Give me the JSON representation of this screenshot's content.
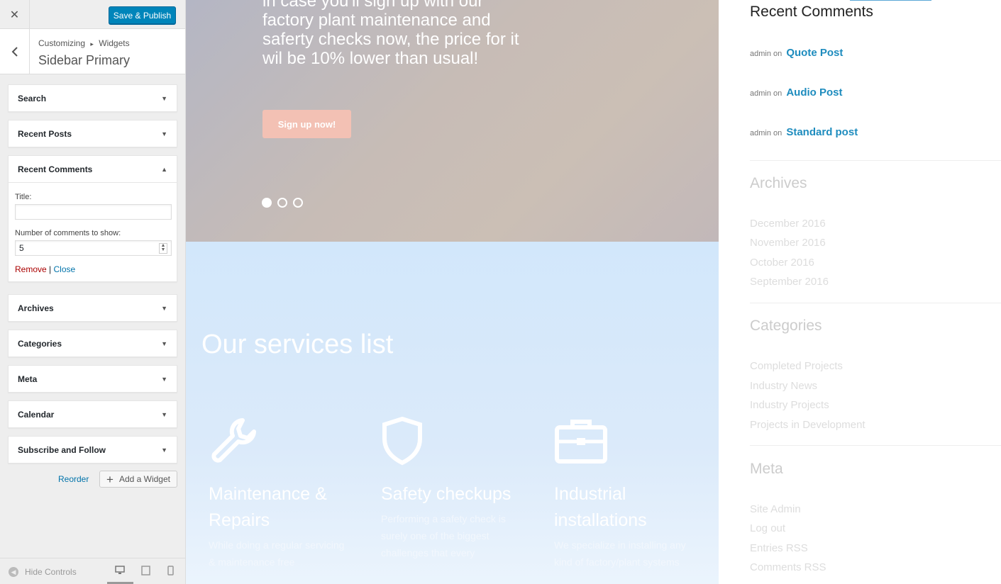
{
  "panel": {
    "close_icon": "close-icon",
    "publish_label": "Save & Publish",
    "breadcrumb_root": "Customizing",
    "breadcrumb_sep": "▸",
    "breadcrumb_leaf": "Widgets",
    "section_title": "Sidebar Primary",
    "widgets": [
      {
        "label": "Search"
      },
      {
        "label": "Recent Posts"
      },
      {
        "label": "Recent Comments"
      },
      {
        "label": "Archives"
      },
      {
        "label": "Categories"
      },
      {
        "label": "Meta"
      },
      {
        "label": "Calendar"
      },
      {
        "label": "Subscribe and Follow"
      }
    ],
    "form": {
      "title_label": "Title:",
      "title_value": "",
      "count_label": "Number of comments to show:",
      "count_value": "5",
      "remove_label": "Remove",
      "close_label": "Close",
      "separator": "|"
    },
    "reorder_label": "Reorder",
    "add_widget_label": "Add a Widget",
    "footer": {
      "hide_label": "Hide Controls"
    }
  },
  "hero": {
    "text": "in case you'll sign up with our factory plant maintenance and saferty checks now, the price for it wil be 10% lower than usual!",
    "button_label": "Sign up now!",
    "slides_active": 1
  },
  "services": {
    "title": "Our services list",
    "items": [
      {
        "icon": "wrench-icon",
        "name": "Maintenance & Repairs",
        "desc": "While doing a regular servicing & maintenance free"
      },
      {
        "icon": "shield-icon",
        "name": "Safety checkups",
        "desc": "Performing a safety check is surely one of the biggest challenges that every"
      },
      {
        "icon": "briefcase-icon",
        "name": "Industrial installations",
        "desc": "We specialize in installing any kind of factory/plant systems"
      }
    ]
  },
  "sidebar_preview": {
    "recent_comments_title": "Recent Comments",
    "comments": [
      {
        "author": "admin",
        "on": "on",
        "post": "Quote Post"
      },
      {
        "author": "admin",
        "on": "on",
        "post": "Audio Post"
      },
      {
        "author": "admin",
        "on": "on",
        "post": "Standard post"
      }
    ],
    "archives_title": "Archives",
    "archives": [
      "December 2016",
      "November 2016",
      "October 2016",
      "September 2016"
    ],
    "categories_title": "Categories",
    "categories": [
      "Completed Projects",
      "Industry News",
      "Industry Projects",
      "Projects in Development"
    ],
    "meta_title": "Meta",
    "meta": [
      "Site Admin",
      "Log out",
      "Entries RSS",
      "Comments RSS"
    ]
  },
  "colors": {
    "accent": "#0085ba",
    "link": "#1e8cbe",
    "remove": "#a00"
  }
}
